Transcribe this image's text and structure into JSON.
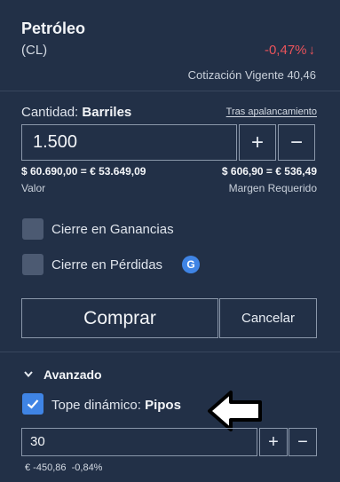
{
  "instrument": {
    "name": "Petróleo",
    "symbol": "(CL)",
    "change": "-0,47%",
    "quote_label": "Cotización Vigente",
    "quote_value": "40,46"
  },
  "quantity": {
    "label_prefix": "Cantidad:",
    "label_unit": "Barriles",
    "leverage_link": "Tras apalancamiento",
    "value": "1.500",
    "plus": "+",
    "minus": "−"
  },
  "summary": {
    "value_amount": "$ 60.690,00 = € 53.649,09",
    "value_label": "Valor",
    "margin_amount": "$ 606,90 = € 536,49",
    "margin_label": "Margen Requerido"
  },
  "options": {
    "take_profit": "Cierre en Ganancias",
    "stop_loss": "Cierre en Pérdidas",
    "badge": "G"
  },
  "actions": {
    "buy": "Comprar",
    "cancel": "Cancelar"
  },
  "advanced": {
    "label": "Avanzado",
    "trailing_label": "Tope dinámico:",
    "trailing_unit": "Pipos",
    "trailing_value": "30",
    "plus": "+",
    "minus": "−",
    "footer_amount": "€ -450,86",
    "footer_percent": "-0,84%"
  },
  "colors": {
    "background": "#223047",
    "negative": "#e8535b",
    "accent": "#3f84e5"
  }
}
